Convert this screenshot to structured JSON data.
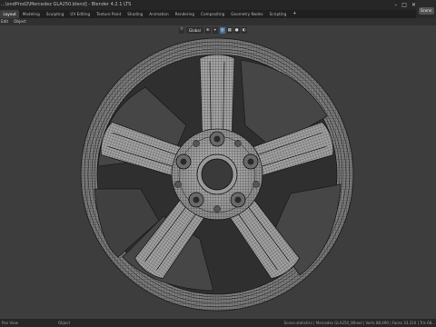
{
  "window": {
    "title": "...\\ondProd2\\Mercedez GLA250.blend] - Blender 4.2.1 LTS",
    "controls": [
      "–",
      "□",
      "✕"
    ]
  },
  "workspace_tabs": [
    "Layout",
    "Modeling",
    "Sculpting",
    "UV Editing",
    "Texture Paint",
    "Shading",
    "Animation",
    "Rendering",
    "Compositing",
    "Geometry Nodes",
    "Scripting",
    "+"
  ],
  "active_tab": "Layout",
  "scene_field": "Scene",
  "header_menu": [
    "Edit",
    "Object"
  ],
  "viewport_toolbar": {
    "orientation": "Global",
    "icons": [
      "cursor-icon",
      "snap-icon",
      "proportional-icon",
      "overlay-icon",
      "shading-solid-icon",
      "shading-material-icon"
    ]
  },
  "statusbar": {
    "left_items": [
      "Pan View",
      "Object"
    ],
    "right_text": "Scene.statistics | Mercedes GLA250_Wheel | Verts 88,490 | Faces 33,210 | Tris 68..."
  },
  "colors": {
    "wheel_face": "#9a9a9a",
    "wheel_shadow": "#2a2a2a",
    "wire": "#1a1a1a",
    "background": "#3d3d3d"
  }
}
